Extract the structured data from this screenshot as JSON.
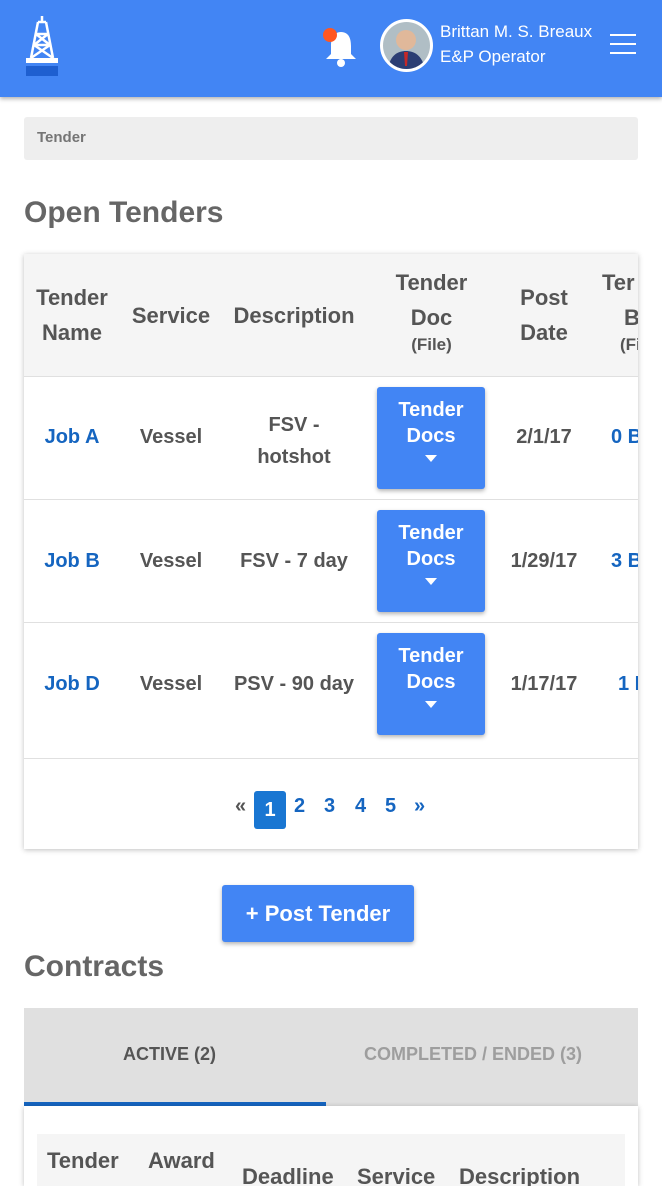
{
  "header": {
    "user_name": "Brittan M. S. Breaux",
    "user_role": "E&P Operator",
    "colors": {
      "primary": "#4285f4",
      "notification": "#ff5722"
    },
    "icons": [
      "oil-rig-logo-icon",
      "bell-icon",
      "avatar",
      "hamburger-menu-icon"
    ]
  },
  "breadcrumb": {
    "current": "Tender"
  },
  "open_tenders": {
    "title": "Open Tenders",
    "columns": {
      "tender_name_1": "Tender",
      "tender_name_2": "Name",
      "service": "Service",
      "description": "Description",
      "tender_doc_1": "Tender",
      "tender_doc_2": "Doc",
      "tender_doc_3": "(File)",
      "post_date_1": "Post",
      "post_date_2": "Date",
      "bids_1": "Ter",
      "bids_2": "B",
      "bids_3": "(Fi"
    },
    "rows": [
      {
        "name": "Job A",
        "service": "Vessel",
        "description_1": "FSV -",
        "description_2": "hotshot",
        "doc_1": "Tender",
        "doc_2": "Docs",
        "post_date": "2/1/17",
        "bids": "0 B"
      },
      {
        "name": "Job B",
        "service": "Vessel",
        "description_1": "FSV - 7 day",
        "description_2": "",
        "doc_1": "Tender",
        "doc_2": "Docs",
        "post_date": "1/29/17",
        "bids": "3 B"
      },
      {
        "name": "Job D",
        "service": "Vessel",
        "description_1": "PSV - 90 day",
        "description_2": "",
        "doc_1": "Tender",
        "doc_2": "Docs",
        "post_date": "1/17/17",
        "bids": "1 I"
      }
    ],
    "pagination": {
      "prev": "«",
      "pages": [
        "1",
        "2",
        "3",
        "4",
        "5"
      ],
      "next": "»",
      "current": 1
    }
  },
  "post_tender_label": "+ Post Tender",
  "contracts": {
    "title": "Contracts",
    "tabs": {
      "active": "ACTIVE (2)",
      "completed": "COMPLETED / ENDED (3)"
    },
    "columns": {
      "tender": "Tender",
      "award": "Award",
      "deadline": "Deadline",
      "service": "Service",
      "description": "Description"
    }
  }
}
